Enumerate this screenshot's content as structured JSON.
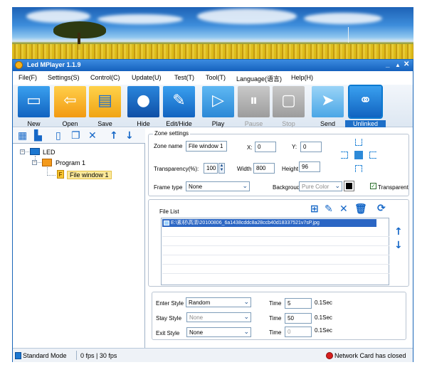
{
  "window": {
    "title": "Led MPlayer 1.1.9",
    "minimize_glyph": "_",
    "restore_glyph": "▲",
    "close_glyph": "✕"
  },
  "menu": [
    {
      "label": "File(F)"
    },
    {
      "label": "Settings(S)"
    },
    {
      "label": "Control(C)"
    },
    {
      "label": "Update(U)"
    },
    {
      "label": "Test(T)"
    },
    {
      "label": "Tool(T)"
    },
    {
      "label": "Language(语言)"
    },
    {
      "label": "Help(H)"
    }
  ],
  "toolbar": {
    "new": "New",
    "open": "Open",
    "save": "Save",
    "hide": "Hide",
    "edit_hide": "Edit/Hide",
    "play": "Play",
    "pause": "Pause",
    "stop": "Stop",
    "send": "Send",
    "unlinked": "Unlinked"
  },
  "tree": {
    "root": "LED",
    "program": "Program 1",
    "file_window": "File window 1",
    "file_glyph": "F"
  },
  "zone": {
    "legend": "Zone settings",
    "zone_name_label": "Zone name",
    "zone_name": "File window 1",
    "x_label": "X:",
    "x": "0",
    "y_label": "Y:",
    "y": "0",
    "transparency_label": "Transparency(%):",
    "transparency": "100",
    "width_label": "Width",
    "width": "800",
    "height_label": "Height",
    "height": "96",
    "frame_type_label": "Frame type",
    "frame_type": "None",
    "background_label": "Backgroud",
    "background": "Pure Color",
    "transparent_label": "Transparent",
    "transparent_checked": true
  },
  "files": {
    "label": "File List",
    "items": [
      "E:\\素材\\高清\\20100806_6a1438cddc8a28ccb40d18337521v7sP.jpg"
    ]
  },
  "style": {
    "enter_label": "Enter Style",
    "enter_value": "Random",
    "stay_label": "Stay Style",
    "stay_value": "None",
    "exit_label": "Exit Style",
    "exit_value": "None",
    "time_label": "Time",
    "enter_time": "5",
    "stay_time": "50",
    "exit_time": "0",
    "unit": "0.1Sec"
  },
  "status": {
    "mode": "Standard Mode",
    "fps": "0 fps | 30 fps",
    "network": "Network Card has closed"
  }
}
